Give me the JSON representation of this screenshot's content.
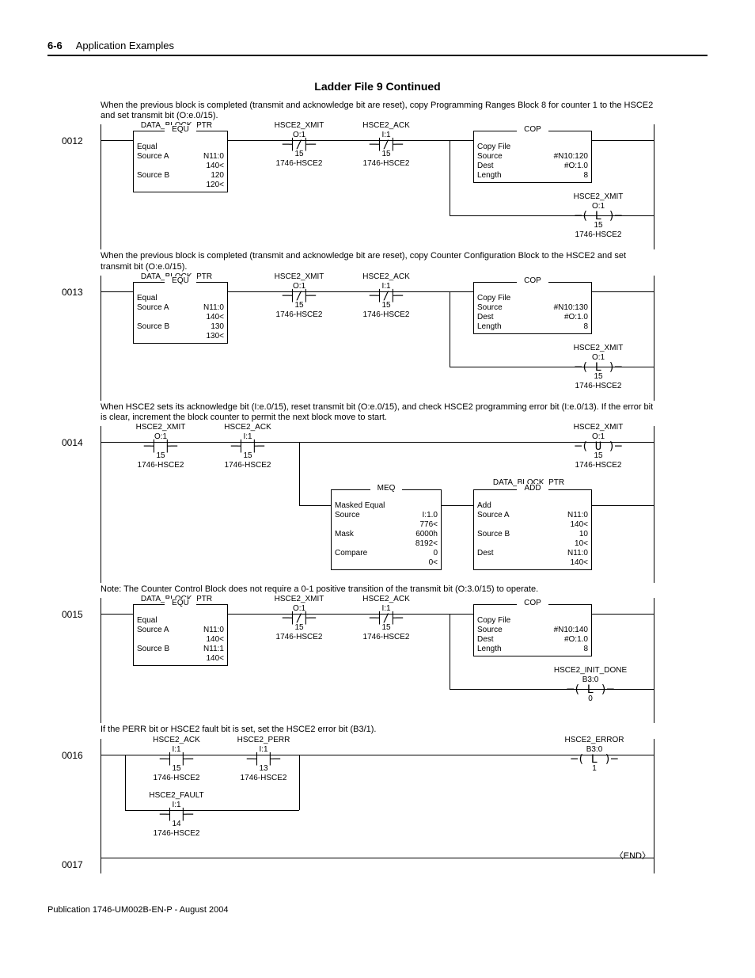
{
  "header": {
    "page": "6-6",
    "section": "Application Examples"
  },
  "title": "Ladder File 9 Continued",
  "comments": {
    "c12": "When the previous block is completed (transmit and acknowledge bit are reset), copy Programming Ranges Block 8 for counter 1 to the HSCE2 and set transmit bit (O:e.0/15).",
    "c13": "When the previous block is completed (transmit and acknowledge bit are reset), copy Counter Configuration Block to the HSCE2 and set transmit bit (O:e.0/15).",
    "c14": "When HSCE2 sets its acknowledge bit (I:e.0/15), reset transmit bit (O:e.0/15), and check HSCE2 programming error bit (I:e.0/13). If the error bit is clear, increment the block counter to permit the next block move to start.",
    "c15": "Note: The Counter Control Block does not require a 0-1 positive transition of the transmit bit (O:3.0/15) to operate.",
    "c16": "If the PERR bit or HSCE2 fault bit is set, set the HSCE2 error bit (B3/1)."
  },
  "tags": {
    "dbp": "DATA_BLOCK_PTR",
    "xmit": "HSCE2_XMIT",
    "ack": "HSCE2_ACK",
    "perr": "HSCE2_PERR",
    "fault": "HSCE2_FAULT",
    "init": "HSCE2_INIT_DONE",
    "err": "HSCE2_ERROR",
    "mod": "1746-HSCE2"
  },
  "rungs": {
    "r12": {
      "num": "0012",
      "equ": {
        "t": "EQU",
        "name": "Equal",
        "sa": "Source A",
        "sav": "N11:0",
        "sax": "140<",
        "sb": "Source B",
        "sbv": "120",
        "sbx": "120<"
      },
      "xmit": {
        "addr": "O:1",
        "bit": "15"
      },
      "ack": {
        "addr": "I:1",
        "bit": "15"
      },
      "cop": {
        "t": "COP",
        "name": "Copy File",
        "src": "Source",
        "srcv": "#N10:120",
        "dst": "Dest",
        "dstv": "#O:1.0",
        "len": "Length",
        "lenv": "8"
      },
      "coil": {
        "addr": "O:1",
        "bit": "15",
        "type": "L"
      }
    },
    "r13": {
      "num": "0013",
      "equ": {
        "t": "EQU",
        "name": "Equal",
        "sa": "Source A",
        "sav": "N11:0",
        "sax": "140<",
        "sb": "Source B",
        "sbv": "130",
        "sbx": "130<"
      },
      "xmit": {
        "addr": "O:1",
        "bit": "15"
      },
      "ack": {
        "addr": "I:1",
        "bit": "15"
      },
      "cop": {
        "t": "COP",
        "name": "Copy File",
        "src": "Source",
        "srcv": "#N10:130",
        "dst": "Dest",
        "dstv": "#O:1.0",
        "len": "Length",
        "lenv": "8"
      },
      "coil": {
        "addr": "O:1",
        "bit": "15",
        "type": "L"
      }
    },
    "r14": {
      "num": "0014",
      "xmit": {
        "addr": "O:1",
        "bit": "15"
      },
      "ack": {
        "addr": "I:1",
        "bit": "15"
      },
      "coil": {
        "addr": "O:1",
        "bit": "15",
        "type": "U"
      },
      "meq": {
        "t": "MEQ",
        "name": "Masked Equal",
        "src": "Source",
        "srcv": "I:1.0",
        "srcx": "776<",
        "mask": "Mask",
        "maskv": "6000h",
        "maskx": "8192<",
        "cmp": "Compare",
        "cmpv": "0",
        "cmpx": "0<"
      },
      "add": {
        "t": "ADD",
        "name": "Add",
        "sa": "Source A",
        "sav": "N11:0",
        "sax": "140<",
        "sb": "Source B",
        "sbv": "10",
        "sbx": "10<",
        "d": "Dest",
        "dv": "N11:0",
        "dx": "140<"
      }
    },
    "r15": {
      "num": "0015",
      "equ": {
        "t": "EQU",
        "name": "Equal",
        "sa": "Source A",
        "sav": "N11:0",
        "sax": "140<",
        "sb": "Source B",
        "sbv": "N11:1",
        "sbx": "140<"
      },
      "xmit": {
        "addr": "O:1",
        "bit": "15"
      },
      "ack": {
        "addr": "I:1",
        "bit": "15"
      },
      "cop": {
        "t": "COP",
        "name": "Copy File",
        "src": "Source",
        "srcv": "#N10:140",
        "dst": "Dest",
        "dstv": "#O:1.0",
        "len": "Length",
        "lenv": "8"
      },
      "coil": {
        "addr": "B3:0",
        "bit": "0",
        "type": "L"
      }
    },
    "r16": {
      "num": "0016",
      "ack": {
        "addr": "I:1",
        "bit": "15"
      },
      "perr": {
        "addr": "I:1",
        "bit": "13"
      },
      "fault": {
        "addr": "I:1",
        "bit": "14"
      },
      "coil": {
        "addr": "B3:0",
        "bit": "1",
        "type": "L"
      }
    },
    "r17": {
      "num": "0017",
      "end": "END"
    }
  },
  "footer": "Publication 1746-UM002B-EN-P - August 2004"
}
